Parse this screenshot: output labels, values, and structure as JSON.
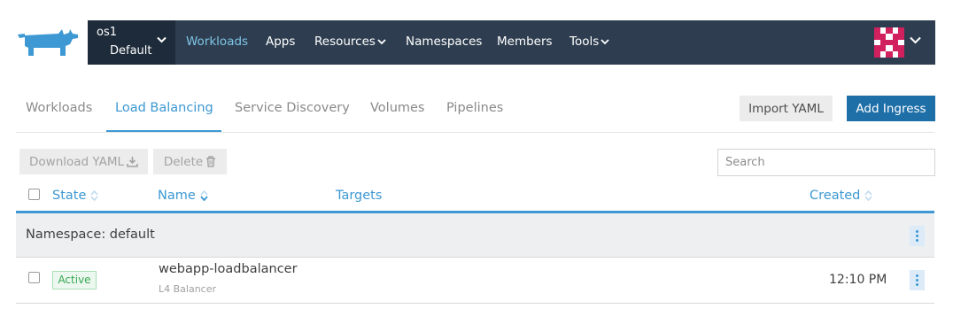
{
  "header": {
    "context": {
      "cluster": "os1",
      "project": "Default"
    },
    "nav": [
      {
        "label": "Workloads",
        "active": true,
        "dropdown": false
      },
      {
        "label": "Apps",
        "active": false,
        "dropdown": false
      },
      {
        "label": "Resources",
        "active": false,
        "dropdown": true
      },
      {
        "label": "Namespaces",
        "active": false,
        "dropdown": false
      },
      {
        "label": "Members",
        "active": false,
        "dropdown": false
      },
      {
        "label": "Tools",
        "active": false,
        "dropdown": true
      }
    ],
    "logo_icon": "cow-logo-icon",
    "avatar_icon": "user-avatar-icon"
  },
  "tabs": [
    {
      "label": "Workloads",
      "active": false
    },
    {
      "label": "Load Balancing",
      "active": true
    },
    {
      "label": "Service Discovery",
      "active": false
    },
    {
      "label": "Volumes",
      "active": false
    },
    {
      "label": "Pipelines",
      "active": false
    }
  ],
  "actions": {
    "import_label": "Import YAML",
    "add_label": "Add Ingress"
  },
  "toolbar": {
    "download_label": "Download YAML",
    "delete_label": "Delete",
    "search_placeholder": "Search"
  },
  "table": {
    "columns": [
      "State",
      "Name",
      "Targets",
      "Created"
    ],
    "groups": [
      {
        "label": "Namespace: default",
        "rows": [
          {
            "state": "Active",
            "name": "webapp-loadbalancer",
            "type": "L4 Balancer",
            "targets": "",
            "created": "12:10 PM"
          }
        ]
      }
    ]
  },
  "colors": {
    "nav_bg": "#2e3e50",
    "context_bg": "#1d2b3a",
    "accent": "#3d98d3",
    "primary_button": "#1e6fa8",
    "active_badge": "#38a754"
  }
}
